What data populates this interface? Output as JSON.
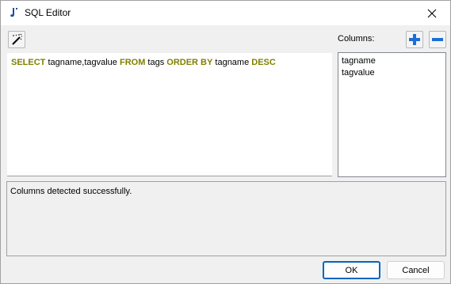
{
  "window": {
    "title": "SQL Editor",
    "icon": "java-icon",
    "close_icon": "close-icon"
  },
  "toolbar": {
    "wand_icon": "magic-wand-icon"
  },
  "columns_panel": {
    "label": "Columns:",
    "add_icon": "plus-icon",
    "remove_icon": "minus-icon",
    "items": [
      "tagname",
      "tagvalue"
    ]
  },
  "editor": {
    "tokens": [
      {
        "text": "SELECT",
        "keyword": true
      },
      {
        "text": " tagname,tagvalue ",
        "keyword": false
      },
      {
        "text": "FROM",
        "keyword": true
      },
      {
        "text": " tags ",
        "keyword": false
      },
      {
        "text": "ORDER BY",
        "keyword": true
      },
      {
        "text": " tagname ",
        "keyword": false
      },
      {
        "text": "DESC",
        "keyword": true
      }
    ]
  },
  "status": {
    "message": "Columns detected successfully."
  },
  "buttons": {
    "ok": "OK",
    "cancel": "Cancel"
  },
  "colors": {
    "keyword": "#808000",
    "accent": "#0067c0",
    "icon_blue": "#1a6fd6"
  }
}
